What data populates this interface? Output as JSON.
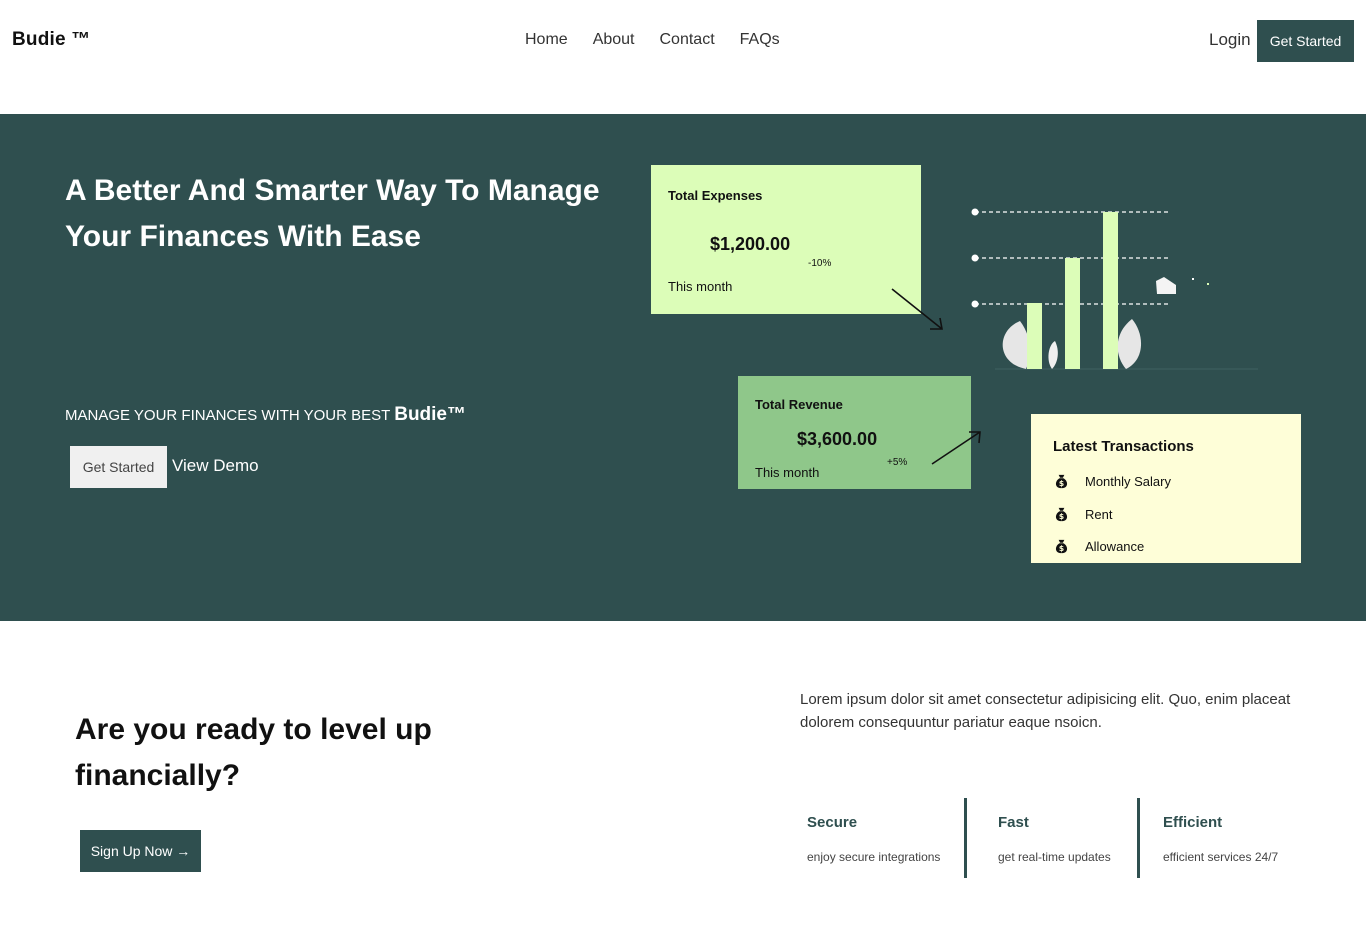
{
  "nav": {
    "brand": "Budie ™",
    "links": [
      "Home",
      "About",
      "Contact",
      "FAQs"
    ],
    "login": "Login",
    "cta": "Get Started"
  },
  "hero": {
    "title": "A Better And Smarter Way To Manage Your Finances With Ease",
    "subtitle_prefix": "MANAGE YOUR FINANCES WITH YOUR BEST ",
    "subtitle_brand": "Budie™",
    "cta": "Get Started",
    "demo": "View Demo",
    "colors": {
      "background": "#2f4f4f",
      "expenses_card": "#dcfdb8",
      "revenue_card": "#8fc78a",
      "transactions_card": "#fefed8",
      "bars": "#dcfdb8"
    }
  },
  "expenses": {
    "label": "Total Expenses",
    "value": "$1,200.00",
    "change": "-10%",
    "period": "This month"
  },
  "revenue": {
    "label": "Total Revenue",
    "value": "$3,600.00",
    "change": "+5%",
    "period": "This month"
  },
  "transactions": {
    "title": "Latest Transactions",
    "items": [
      "Monthly Salary",
      "Rent",
      "Allowance"
    ],
    "icon": "money-bag-icon"
  },
  "cta_section": {
    "title": "Are you ready to level up financially?",
    "button": "Sign Up Now →",
    "text": "Lorem ipsum dolor sit amet consectetur adipisicing elit. Quo, enim placeat dolorem consequuntur pariatur eaque nsoicn."
  },
  "features": [
    {
      "title": "Secure",
      "desc": "enjoy secure integrations"
    },
    {
      "title": "Fast",
      "desc": "get real-time updates"
    },
    {
      "title": "Efficient",
      "desc": "efficient services 24/7"
    }
  ]
}
